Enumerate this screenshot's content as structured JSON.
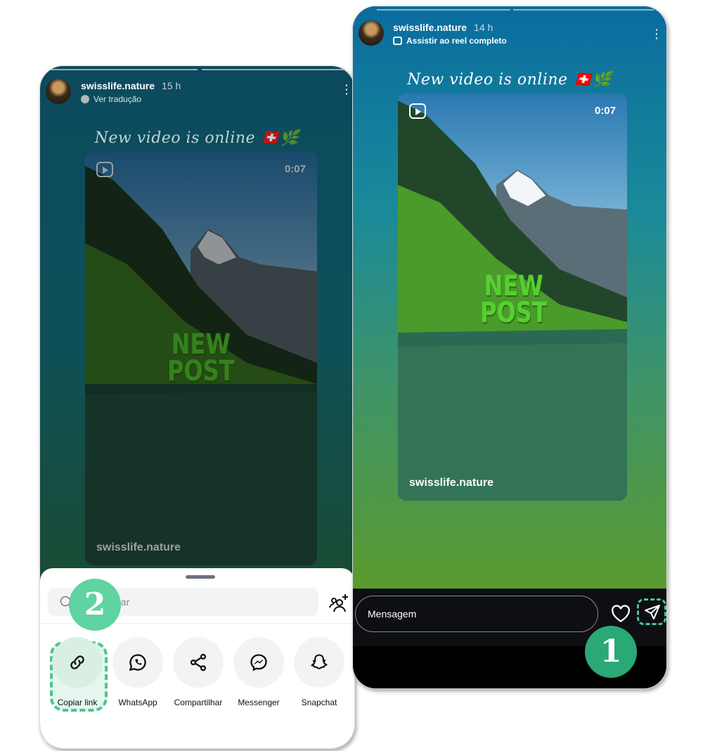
{
  "left_screen": {
    "username": "swisslife.nature",
    "time": "15 h",
    "subtitle": "Ver tradução",
    "caption": "New video is online 🇨🇭🌿",
    "video": {
      "duration": "0:07",
      "overlay_text_1": "NEW",
      "overlay_text_2": "POST",
      "watermark": "swisslife.nature"
    },
    "share_sheet": {
      "search_placeholder": "Pesquisar",
      "options": [
        {
          "label": "Copiar link",
          "icon": "link-icon"
        },
        {
          "label": "WhatsApp",
          "icon": "whatsapp-icon"
        },
        {
          "label": "Compartilhar",
          "icon": "share-icon"
        },
        {
          "label": "Messenger",
          "icon": "messenger-icon"
        },
        {
          "label": "Snapchat",
          "icon": "snapchat-icon"
        }
      ]
    }
  },
  "right_screen": {
    "username": "swisslife.nature",
    "time": "14 h",
    "subtitle": "Assistir ao reel completo",
    "caption": "New video is online 🇨🇭🌿",
    "video": {
      "duration": "0:07",
      "overlay_text_1": "NEW",
      "overlay_text_2": "POST",
      "watermark": "swisslife.nature"
    },
    "message_placeholder": "Mensagem"
  },
  "steps": [
    {
      "number": "1",
      "color": "#2aa876"
    },
    {
      "number": "2",
      "color": "#5fd3a0"
    }
  ],
  "colors": {
    "highlight": "#4cc48e"
  }
}
